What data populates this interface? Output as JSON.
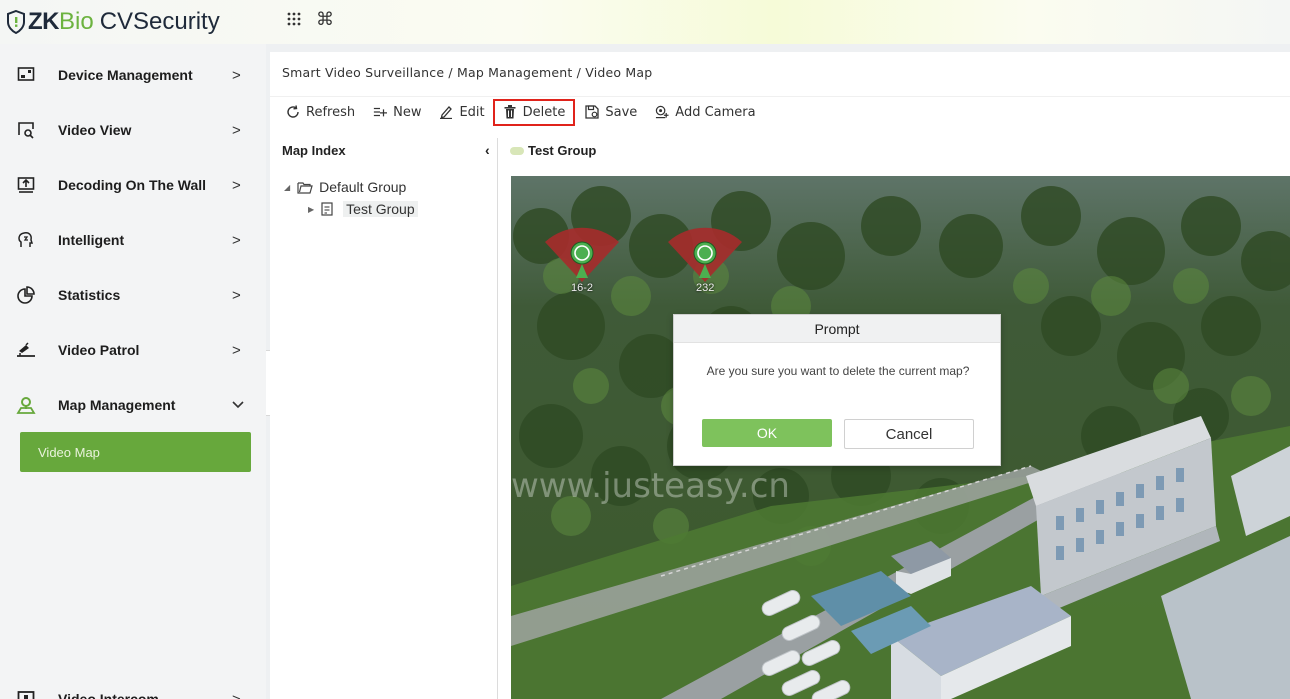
{
  "header": {
    "logo_zk": "ZK",
    "logo_bio": "Bio",
    "logo_cv": "CVSecurity",
    "apps_icon": "grid-icon",
    "command_icon": "command-icon"
  },
  "sidebar": {
    "items": [
      {
        "label": "Device Management",
        "icon": "device-icon",
        "arrow": ">"
      },
      {
        "label": "Video View",
        "icon": "video-view-icon",
        "arrow": ">"
      },
      {
        "label": "Decoding On The Wall",
        "icon": "decode-wall-icon",
        "arrow": ">"
      },
      {
        "label": "Intelligent",
        "icon": "intelligent-icon",
        "arrow": ">"
      },
      {
        "label": "Statistics",
        "icon": "statistics-icon",
        "arrow": ">"
      },
      {
        "label": "Video Patrol",
        "icon": "patrol-icon",
        "arrow": ">"
      },
      {
        "label": "Map Management",
        "icon": "map-icon",
        "arrow": "⌄"
      },
      {
        "label": "Video Intercom",
        "icon": "intercom-icon",
        "arrow": ">"
      }
    ],
    "submenu_active": "Video Map",
    "collapse_symbol": "«"
  },
  "breadcrumb": "Smart Video Surveillance / Map Management / Video Map",
  "toolbar": {
    "refresh": "Refresh",
    "new": "New",
    "edit": "Edit",
    "delete": "Delete",
    "save": "Save",
    "add_camera": "Add Camera"
  },
  "map_index": {
    "title": "Map Index",
    "collapse": "‹",
    "tree": [
      {
        "label": "Default Group"
      },
      {
        "label": "Test Group"
      }
    ]
  },
  "map_header": "Test Group",
  "cameras": [
    {
      "label": "16-2"
    },
    {
      "label": "232"
    }
  ],
  "watermark": "www.justeasy.cn",
  "dialog": {
    "title": "Prompt",
    "message": "Are you sure you want to delete the current map?",
    "ok": "OK",
    "cancel": "Cancel"
  },
  "colors": {
    "accent_green": "#67a83c",
    "ok_green": "#7ec25c",
    "highlight_red": "#e0231b",
    "camera_red": "#a62b2b"
  }
}
